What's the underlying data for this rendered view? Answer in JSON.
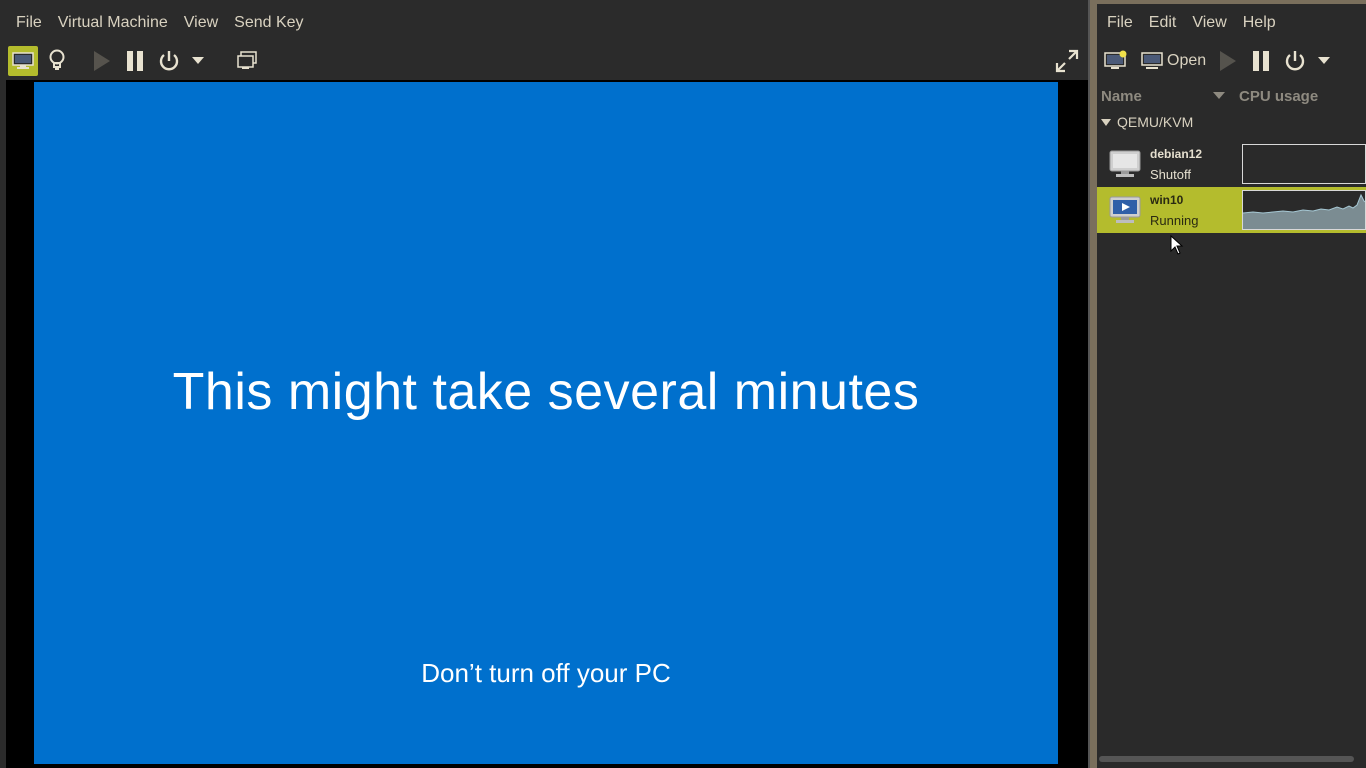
{
  "viewer": {
    "menu": [
      "File",
      "Virtual Machine",
      "View",
      "Send Key"
    ],
    "toolbar_icons": [
      "monitor-icon",
      "lightbulb-icon",
      "play-icon",
      "pause-icon",
      "power-icon",
      "dropdown-arrow-icon",
      "screenshot-icon",
      "fullscreen-icon"
    ],
    "guest": {
      "title": "This might take several minutes",
      "subtitle": "Don’t turn off your PC",
      "background": "#0070cd"
    }
  },
  "manager": {
    "menu": [
      "File",
      "Edit",
      "View",
      "Help"
    ],
    "toolbar": {
      "open_label": "Open"
    },
    "columns": {
      "name": "Name",
      "cpu": "CPU usage"
    },
    "group": "QEMU/KVM",
    "vms": [
      {
        "name": "debian12",
        "state": "Shutoff",
        "selected": false
      },
      {
        "name": "win10",
        "state": "Running",
        "selected": true
      }
    ],
    "accent": "#b4bc2d"
  }
}
